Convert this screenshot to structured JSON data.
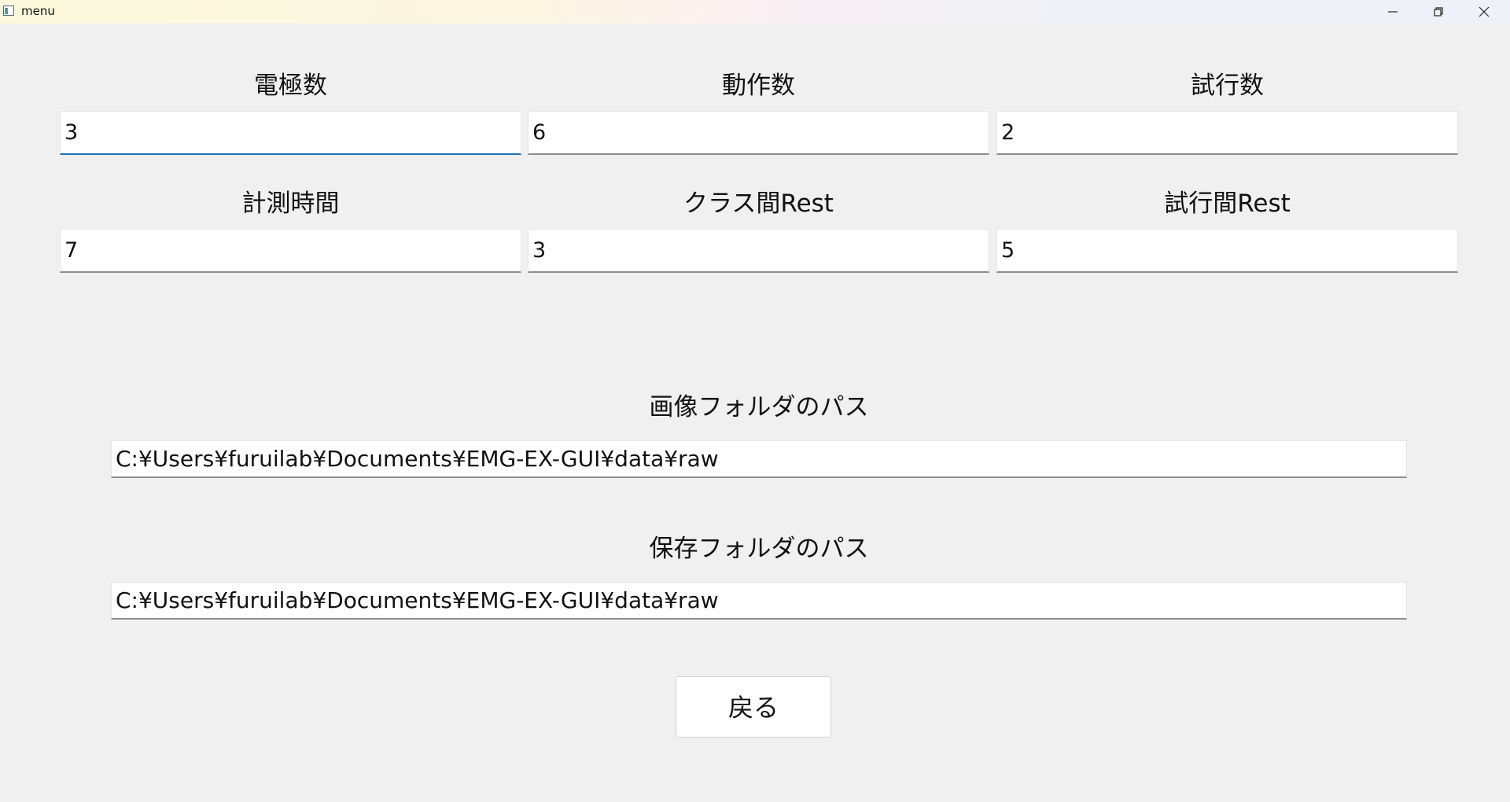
{
  "window": {
    "title": "menu",
    "icon": "app-window-icon",
    "controls": [
      "minimize-icon",
      "restore-icon",
      "close-icon"
    ]
  },
  "settings": {
    "electrodes": {
      "label": "電極数",
      "value": "3"
    },
    "motions": {
      "label": "動作数",
      "value": "6"
    },
    "trials": {
      "label": "試行数",
      "value": "2"
    },
    "measure_time": {
      "label": "計測時間",
      "value": "7"
    },
    "class_rest": {
      "label": "クラス間Rest",
      "value": "3"
    },
    "trial_rest": {
      "label": "試行間Rest",
      "value": "5"
    }
  },
  "paths": {
    "image_folder": {
      "label": "画像フォルダのパス",
      "value": "C:¥Users¥furuilab¥Documents¥EMG-EX-GUI¥data¥raw"
    },
    "save_folder": {
      "label": "保存フォルダのパス",
      "value": "C:¥Users¥furuilab¥Documents¥EMG-EX-GUI¥data¥raw"
    }
  },
  "actions": {
    "back_label": "戻る"
  },
  "colors": {
    "background": "#f0f0f0",
    "focus_accent": "#1c6fb8",
    "field_background": "#ffffff"
  }
}
